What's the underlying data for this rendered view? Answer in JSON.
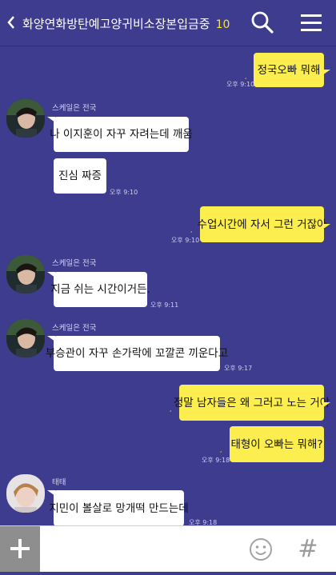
{
  "header": {
    "title": "화양연화방탄예고양귀비소장본입금중",
    "member_count": "10",
    "back_icon": "chevron-left-icon",
    "search_icon": "search-icon",
    "menu_icon": "hamburger-menu-icon"
  },
  "messages": [
    {
      "sender": "me",
      "text": "정국오빠 뭐해",
      "time": "오후 9:10"
    },
    {
      "sender": "스케일은 전국",
      "text": "나 이지훈이 자꾸 자려는데 깨움"
    },
    {
      "sender": "스케일은 전국",
      "text": "진심 짜증",
      "time": "오후 9:10"
    },
    {
      "sender": "me",
      "text": "수업시간에 자서 그런 거잖아",
      "time": "오후 9:10"
    },
    {
      "sender": "스케일은 전국",
      "text": "지금 쉬는 시간이거든.",
      "time": "오후 9:11"
    },
    {
      "sender": "스케일은 전국",
      "text": "부승관이 자꾸 손가락에 꼬깔콘 끼운다고",
      "time": "오후 9:17"
    },
    {
      "sender": "me",
      "text": "정말 남자들은 왜 그러고 노는 거야"
    },
    {
      "sender": "me",
      "text": "태형이 오빠는 뭐해?",
      "time": "오후 9:18"
    },
    {
      "sender": "태태",
      "text": "지민이 볼살로 망개떡 만드는데",
      "time": "오후 9:18"
    }
  ],
  "input": {
    "placeholder": "",
    "plus_label": "+",
    "emoji_icon": "emoticon-icon",
    "hash_label": "#"
  },
  "colors": {
    "background": "#3e3c8f",
    "my_bubble": "#fdee4f",
    "other_bubble": "#ffffff",
    "accent": "#f5e43c"
  }
}
